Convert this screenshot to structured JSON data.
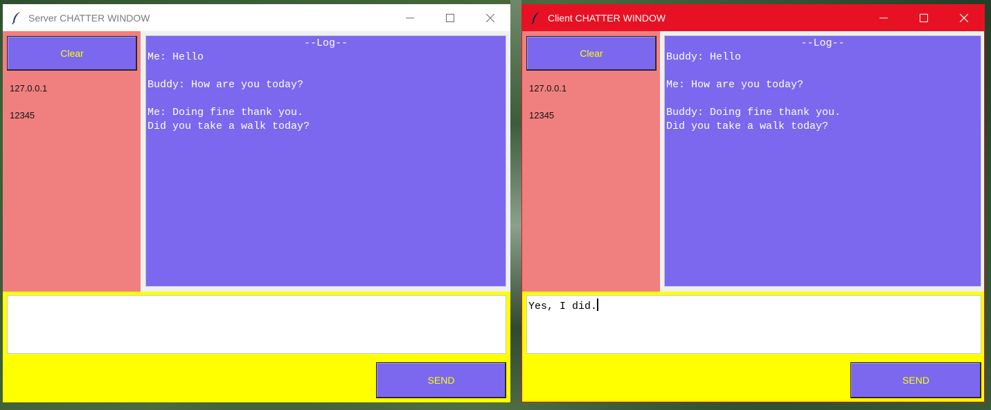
{
  "server_window": {
    "title": "Server CHATTER WINDOW",
    "clear_label": "Clear",
    "ip": "127.0.0.1",
    "port": "12345",
    "log_header": "--Log--",
    "log_text": "Me: Hello\n\nBuddy: How are you today?\n\nMe: Doing fine thank you.\nDid you take a walk today?",
    "message_value": "",
    "send_label": "SEND"
  },
  "client_window": {
    "title": "Client CHATTER WINDOW",
    "clear_label": "Clear",
    "ip": "127.0.0.1",
    "port": "12345",
    "log_header": "--Log--",
    "log_text": "Buddy: Hello\n\nMe: How are you today?\n\nBuddy: Doing fine thank you.\nDid you take a walk today?",
    "message_value": "Yes, I did.",
    "send_label": "SEND"
  },
  "colors": {
    "panel": "#f08080",
    "log_bg": "#7b68ee",
    "button_bg": "#7b68ee",
    "button_text": "#ffff00",
    "bottom_bg": "#ffff00",
    "active_titlebar": "#e81123"
  },
  "icons": {
    "app": "feather-icon",
    "minimize": "minimize-icon",
    "maximize": "maximize-icon",
    "close": "close-icon"
  }
}
